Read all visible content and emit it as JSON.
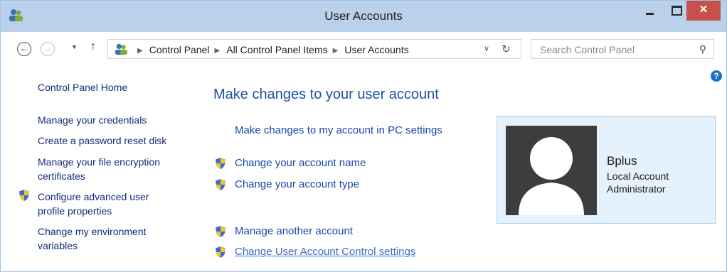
{
  "window": {
    "title": "User Accounts",
    "close_glyph": "✕",
    "colors": {
      "titlebar": "#b9d1ea",
      "close": "#c7504a",
      "link": "#1e4fa8",
      "tile": "#e6f2fb"
    }
  },
  "nav": {
    "back_glyph": "←",
    "forward_glyph": "→",
    "dropdown_glyph": "▼",
    "up_glyph": "↑",
    "address_icon": "users-icon",
    "breadcrumbs": [
      "Control Panel",
      "All Control Panel Items",
      "User Accounts"
    ],
    "crumb_separator": "▶",
    "address_dropdown_glyph": "∨",
    "refresh_glyph": "↻",
    "search": {
      "placeholder": "Search Control Panel",
      "icon_glyph": "⚲"
    },
    "help_glyph": "?"
  },
  "sidebar": {
    "home": "Control Panel Home",
    "items": [
      {
        "label": "Manage your credentials"
      },
      {
        "label": "Create a password reset disk"
      },
      {
        "label_line1": "Manage your file encryption",
        "label_line2": "certificates"
      },
      {
        "label_line1": "Configure advanced user",
        "label_line2": "profile properties",
        "icon": "uac-shield-icon"
      },
      {
        "label_line1": "Change my environment",
        "label_line2": "variables"
      }
    ]
  },
  "main": {
    "heading": "Make changes to your user account",
    "pc_settings_link": "Make changes to my account in PC settings",
    "actions": [
      {
        "label": "Change your account name",
        "icon": "uac-shield-icon"
      },
      {
        "label": "Change your account type",
        "icon": "uac-shield-icon"
      },
      {
        "label": "Manage another account",
        "icon": "uac-shield-icon"
      },
      {
        "label": "Change User Account Control settings",
        "icon": "uac-shield-icon"
      }
    ]
  },
  "account": {
    "name": "Bplus",
    "type": "Local Account",
    "role": "Administrator",
    "avatar_icon": "default-user-avatar"
  }
}
